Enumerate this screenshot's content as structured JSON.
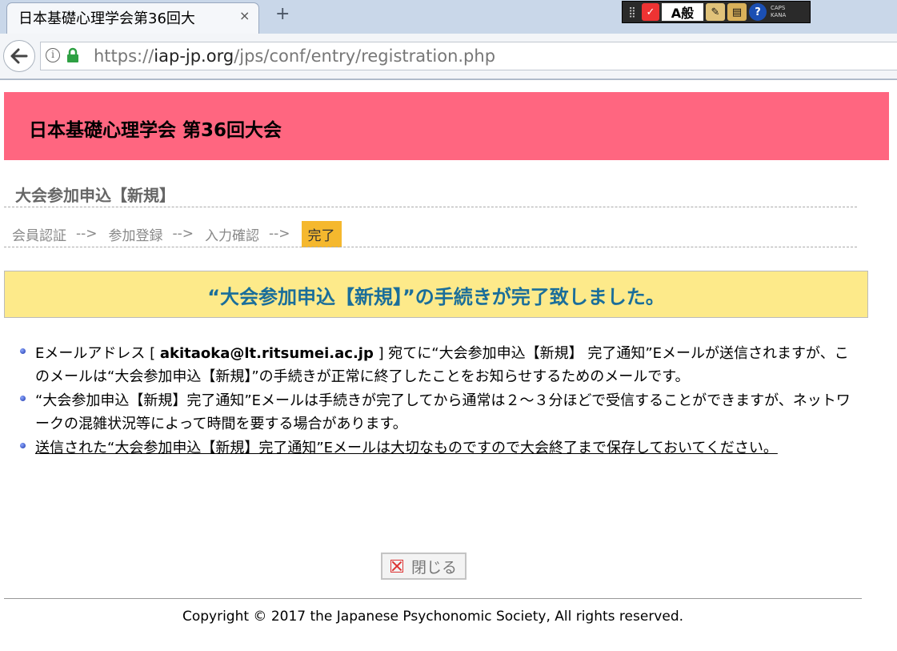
{
  "browser": {
    "tab_title": "日本基礎心理学会第36回大",
    "tab_close": "×",
    "new_tab": "+",
    "url_scheme": "https://",
    "url_host": "iap-jp.org",
    "url_path": "/jps/conf/entry/registration.php",
    "ime": {
      "mode_label": "A般",
      "caps_label": "CAPS",
      "kana_label": "KANA"
    }
  },
  "page": {
    "site_title": "日本基礎心理学会 第36回大会",
    "heading": "大会参加申込【新規】",
    "steps": [
      {
        "label": "会員認証",
        "state": "done"
      },
      {
        "label": "参加登録",
        "state": "done"
      },
      {
        "label": "入力確認",
        "state": "done"
      },
      {
        "label": "完了",
        "state": "current"
      }
    ],
    "step_arrow": "-->",
    "completion_message": "“大会参加申込【新規】”の手続きが完了致しました。",
    "notes": [
      {
        "pre": "Eメールアドレス [ ",
        "email": "akitaoka@lt.ritsumei.ac.jp",
        "post": " ] 宛てに“大会参加申込【新規】 完了通知”Eメールが送信されますが、このメールは“大会参加申込【新規】”の手続きが正常に終了したことをお知らせするためのメールです。"
      },
      {
        "text": "“大会参加申込【新規】完了通知”Eメールは手続きが完了してから通常は２～３分ほどで受信することができますが、ネットワークの混雑状況等によって時間を要する場合があります。"
      },
      {
        "text": "送信された“大会参加申込【新規】完了通知”Eメールは大切なものですので大会終了まで保存しておいてください。"
      }
    ],
    "close_button": "閉じる",
    "copyright": "Copyright © 2017 the Japanese Psychonomic Society, All rights reserved."
  },
  "colors": {
    "header_bg": "#ff6680",
    "current_step_bg": "#f5b82e",
    "message_bg": "#fdea8a",
    "message_text": "#1a6e9a"
  }
}
